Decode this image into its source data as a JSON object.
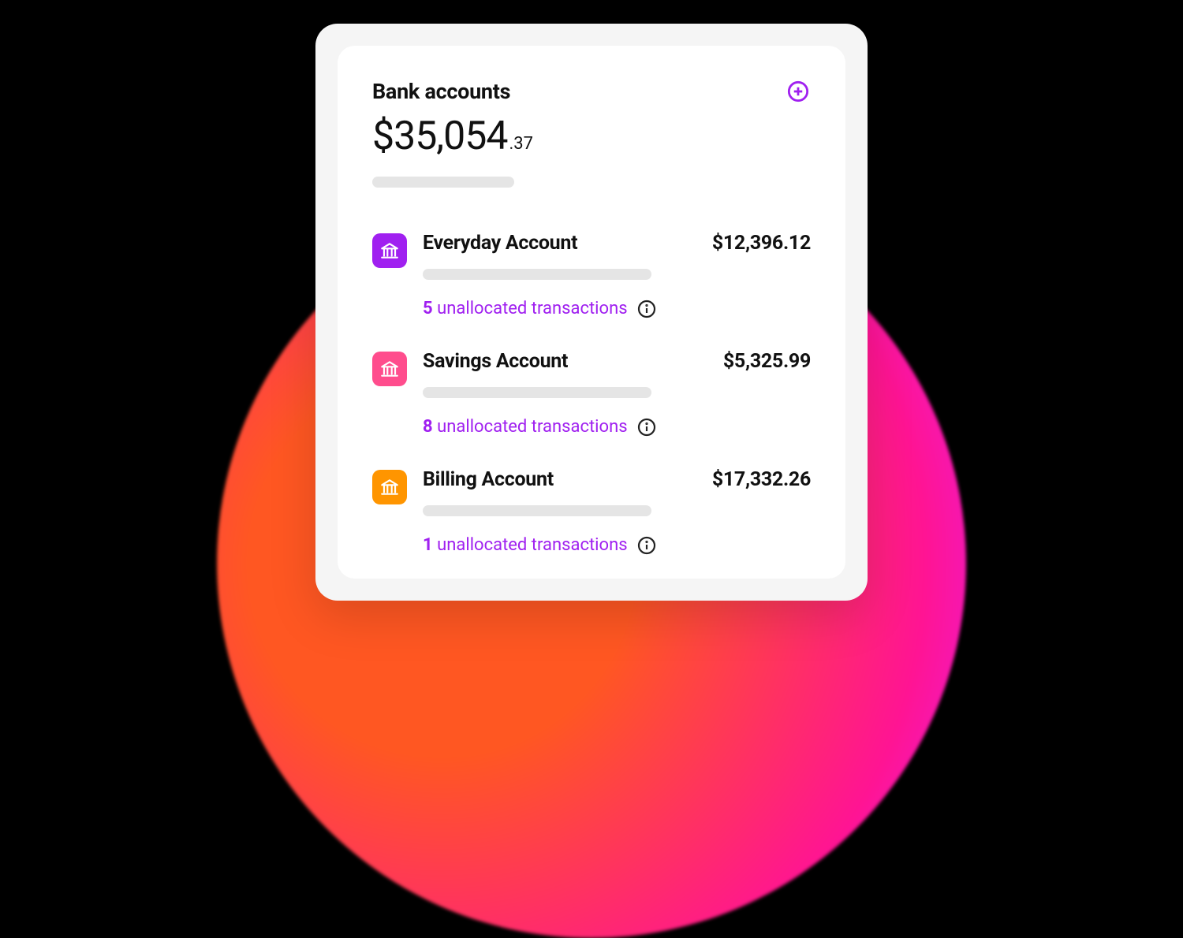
{
  "header": {
    "title": "Bank accounts"
  },
  "total": {
    "whole": "$35,054",
    "decimal": ".37"
  },
  "unallocated_label": "unallocated transactions",
  "accounts": [
    {
      "name": "Everyday Account",
      "balance": "$12,396.12",
      "unallocated_count": "5",
      "icon_color": "purple"
    },
    {
      "name": "Savings Account",
      "balance": "$5,325.99",
      "unallocated_count": "8",
      "icon_color": "pink"
    },
    {
      "name": "Billing Account",
      "balance": "$17,332.26",
      "unallocated_count": "1",
      "icon_color": "orange"
    }
  ]
}
